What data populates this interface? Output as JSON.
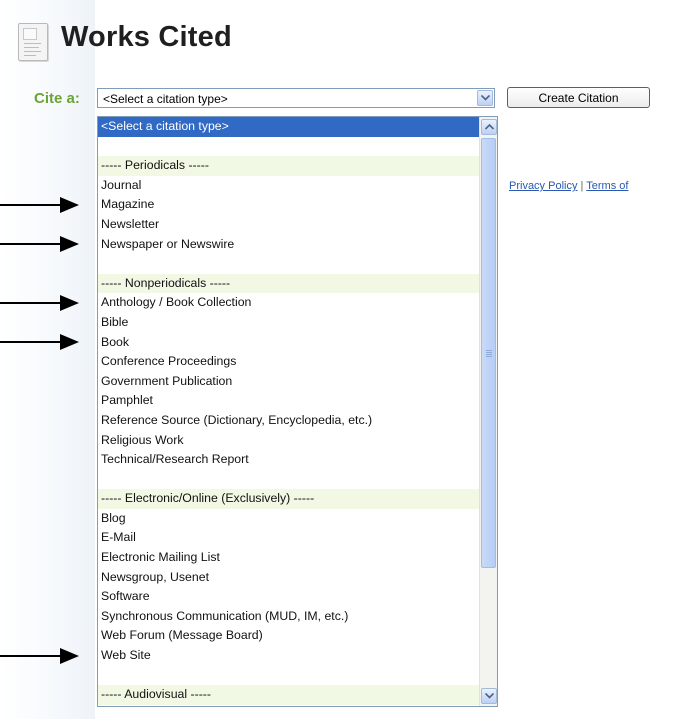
{
  "title": "Works Cited",
  "cite_label": "Cite a:",
  "select": {
    "value": "<Select a citation type>"
  },
  "create_button": "Create Citation",
  "links": {
    "privacy": "Privacy Policy",
    "separator": "|",
    "terms": "Terms of"
  },
  "options": [
    {
      "label": "<Select a citation type>",
      "type": "selected"
    },
    {
      "label": "",
      "type": "blank"
    },
    {
      "label": "----- Periodicals -----",
      "type": "header"
    },
    {
      "label": "Journal",
      "type": "item"
    },
    {
      "label": "Magazine",
      "type": "item"
    },
    {
      "label": "Newsletter",
      "type": "item"
    },
    {
      "label": "Newspaper or Newswire",
      "type": "item"
    },
    {
      "label": "",
      "type": "blank"
    },
    {
      "label": "----- Nonperiodicals -----",
      "type": "header"
    },
    {
      "label": "Anthology / Book Collection",
      "type": "item"
    },
    {
      "label": "Bible",
      "type": "item"
    },
    {
      "label": "Book",
      "type": "item"
    },
    {
      "label": "Conference Proceedings",
      "type": "item"
    },
    {
      "label": "Government Publication",
      "type": "item"
    },
    {
      "label": "Pamphlet",
      "type": "item"
    },
    {
      "label": "Reference Source (Dictionary, Encyclopedia, etc.)",
      "type": "item"
    },
    {
      "label": "Religious Work",
      "type": "item"
    },
    {
      "label": "Technical/Research Report",
      "type": "item"
    },
    {
      "label": "",
      "type": "blank"
    },
    {
      "label": "----- Electronic/Online (Exclusively) -----",
      "type": "header"
    },
    {
      "label": "Blog",
      "type": "item"
    },
    {
      "label": "E-Mail",
      "type": "item"
    },
    {
      "label": "Electronic Mailing List",
      "type": "item"
    },
    {
      "label": "Newsgroup, Usenet",
      "type": "item"
    },
    {
      "label": "Software",
      "type": "item"
    },
    {
      "label": "Synchronous Communication (MUD, IM, etc.)",
      "type": "item"
    },
    {
      "label": "Web Forum (Message Board)",
      "type": "item"
    },
    {
      "label": "Web Site",
      "type": "item"
    },
    {
      "label": "",
      "type": "blank"
    },
    {
      "label": "----- Audiovisual -----",
      "type": "header"
    }
  ],
  "annotation_arrows": [
    {
      "points_to": "Magazine"
    },
    {
      "points_to": "Newspaper or Newswire"
    },
    {
      "points_to": "Anthology / Book Collection"
    },
    {
      "points_to": "Book"
    },
    {
      "points_to": "Web Site"
    }
  ],
  "colors": {
    "cite_label": "#6aa336",
    "selected_bg": "#316ac5",
    "header_bg": "#f1f8e3",
    "link": "#2a58b2",
    "select_border": "#7f9db9"
  },
  "icons": {
    "page_icon": "document-icon",
    "dropdown": "chevron-down-icon",
    "scroll_up": "chevron-up-icon",
    "scroll_down": "chevron-down-icon"
  }
}
